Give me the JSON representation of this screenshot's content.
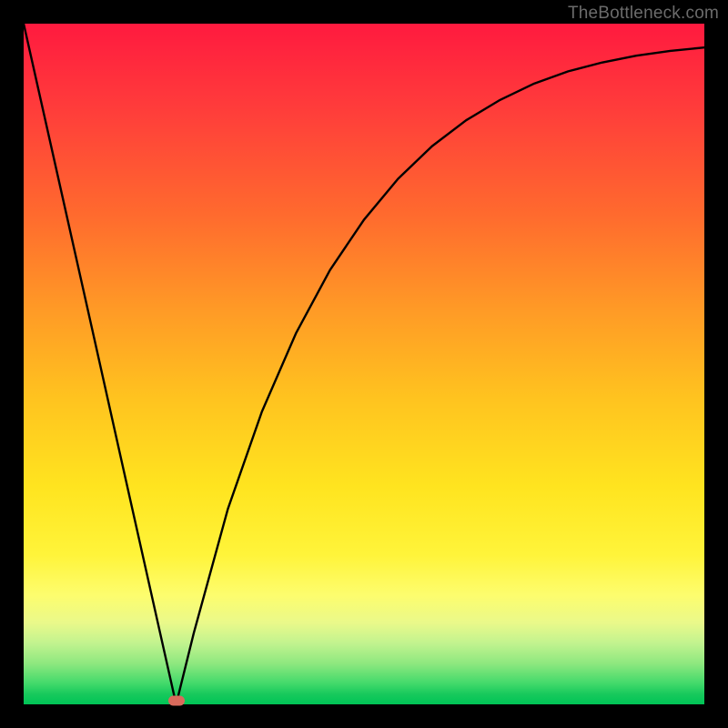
{
  "watermark": "TheBottleneck.com",
  "chart_data": {
    "type": "line",
    "title": "",
    "xlabel": "",
    "ylabel": "",
    "xlim": [
      0,
      1
    ],
    "ylim": [
      0,
      1
    ],
    "grid": false,
    "curve": {
      "x": [
        0.0,
        0.05,
        0.1,
        0.15,
        0.2,
        0.224,
        0.25,
        0.3,
        0.35,
        0.4,
        0.45,
        0.5,
        0.55,
        0.6,
        0.65,
        0.7,
        0.75,
        0.8,
        0.85,
        0.9,
        0.95,
        1.0
      ],
      "y": [
        1.0,
        0.777,
        0.554,
        0.33,
        0.107,
        0.0,
        0.105,
        0.287,
        0.43,
        0.545,
        0.638,
        0.712,
        0.772,
        0.82,
        0.858,
        0.888,
        0.912,
        0.93,
        0.943,
        0.953,
        0.96,
        0.965
      ]
    },
    "marker": {
      "x": 0.224,
      "y": 0.0,
      "color": "#d96a5c"
    },
    "gradient_stops": [
      {
        "pos": 0.0,
        "color": "#ff1a3f"
      },
      {
        "pos": 0.28,
        "color": "#ff6a2e"
      },
      {
        "pos": 0.55,
        "color": "#ffc31f"
      },
      {
        "pos": 0.78,
        "color": "#fff43a"
      },
      {
        "pos": 0.94,
        "color": "#8ee87f"
      },
      {
        "pos": 1.0,
        "color": "#00c456"
      }
    ]
  }
}
